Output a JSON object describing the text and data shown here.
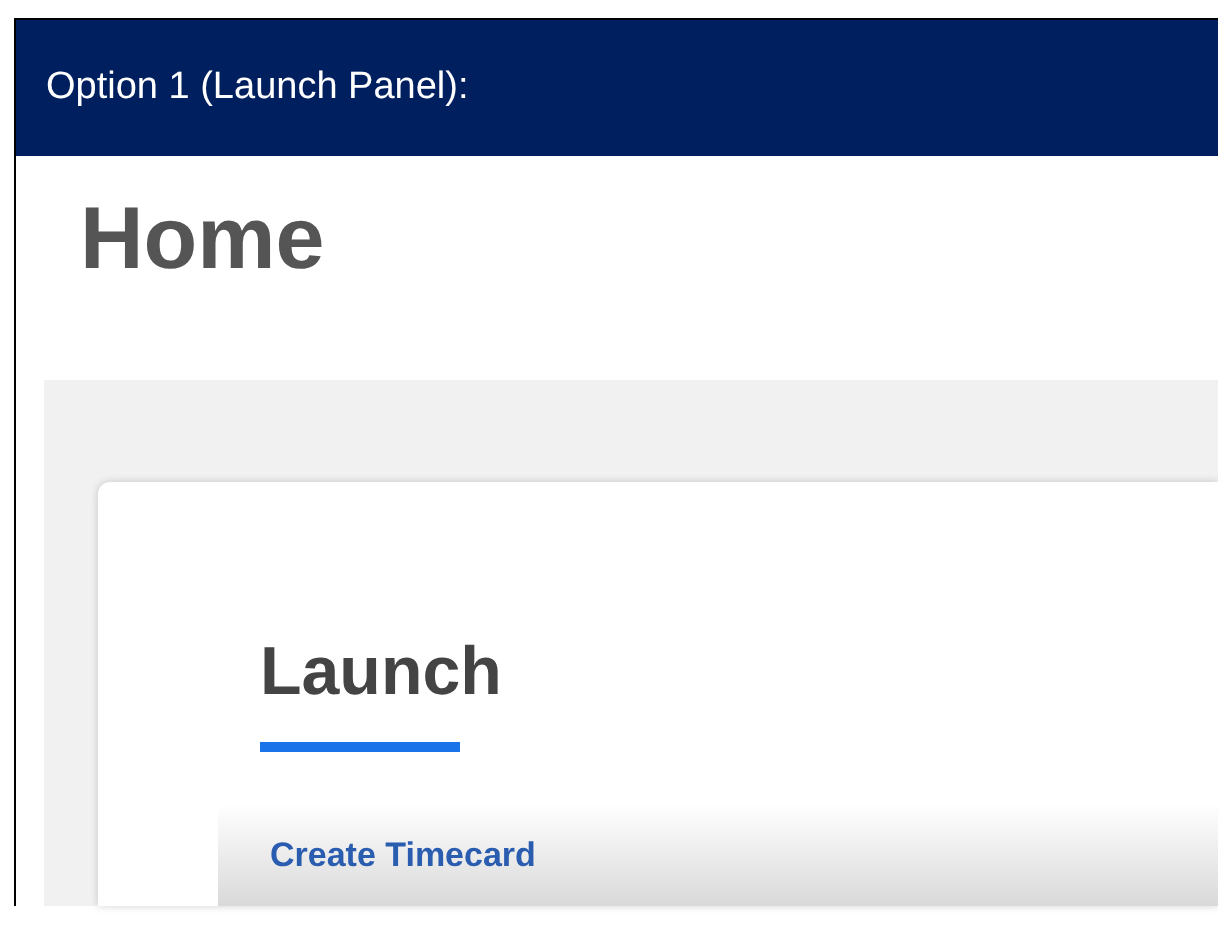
{
  "header": {
    "title": "Option 1 (Launch Panel):"
  },
  "page": {
    "title": "Home"
  },
  "card": {
    "title": "Launch",
    "links": [
      {
        "label": "Create Timecard"
      }
    ]
  }
}
